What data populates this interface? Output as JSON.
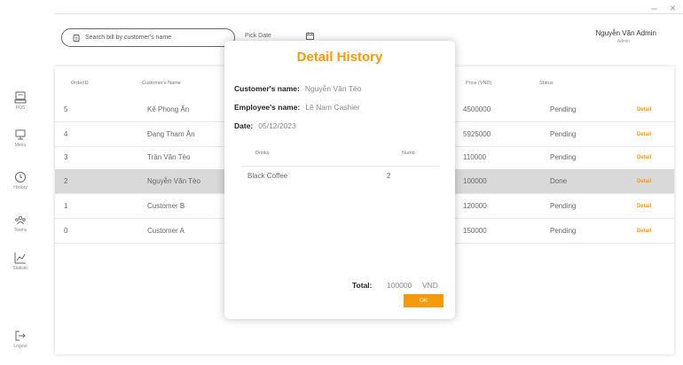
{
  "window": {
    "minimize": "–",
    "close": "×"
  },
  "sidebar": {
    "items": [
      {
        "label": "POS",
        "icon": "pos-icon"
      },
      {
        "label": "Menu",
        "icon": "menu-icon"
      },
      {
        "label": "History",
        "icon": "history-icon"
      },
      {
        "label": "Teams",
        "icon": "teams-icon"
      },
      {
        "label": "Statistic",
        "icon": "statistic-icon"
      },
      {
        "label": "Logout",
        "icon": "logout-icon"
      }
    ]
  },
  "header": {
    "search_placeholder": "Search bill by customer's name",
    "pick_date": "Pick Date",
    "user_name": "Nguyễn Văn Admin",
    "user_role": "Admin"
  },
  "table": {
    "columns": [
      "OrderID",
      "Customer's Name",
      "Price (VND)",
      "Status"
    ],
    "rows": [
      {
        "id": "5",
        "customer": "Kế Phong Ấn",
        "price": "4500000",
        "status": "Pending",
        "action": "Detail"
      },
      {
        "id": "4",
        "customer": "Đang Tham Ăn",
        "price": "5925000",
        "status": "Pending",
        "action": "Detail"
      },
      {
        "id": "3",
        "customer": "Trần Văn Tèo",
        "price": "110000",
        "status": "Pending",
        "action": "Detail"
      },
      {
        "id": "2",
        "customer": "Nguyễn Văn Tèo",
        "price": "100000",
        "status": "Done",
        "action": "Detail"
      },
      {
        "id": "1",
        "customer": "Customer B",
        "price": "120000",
        "status": "Pending",
        "action": "Detail"
      },
      {
        "id": "0",
        "customer": "Customer A",
        "price": "150000",
        "status": "Pending",
        "action": "Detail"
      }
    ]
  },
  "modal": {
    "title": "Detail History",
    "customer_label": "Customer's name:",
    "customer_value": "Nguyễn Văn Tèo",
    "employee_label": "Employee's name:",
    "employee_value": "Lê Nam Cashier",
    "date_label": "Date:",
    "date_value": "05/12/2023",
    "columns": [
      "Drinks",
      "Numb"
    ],
    "items": [
      {
        "drink": "Black Coffee",
        "numb": "2"
      }
    ],
    "total_label": "Total:",
    "total_value": "100000",
    "total_unit": "VND",
    "ok_label": "OK"
  },
  "colors": {
    "accent": "#f59a0a",
    "selected_row": "#d9d9d9"
  }
}
